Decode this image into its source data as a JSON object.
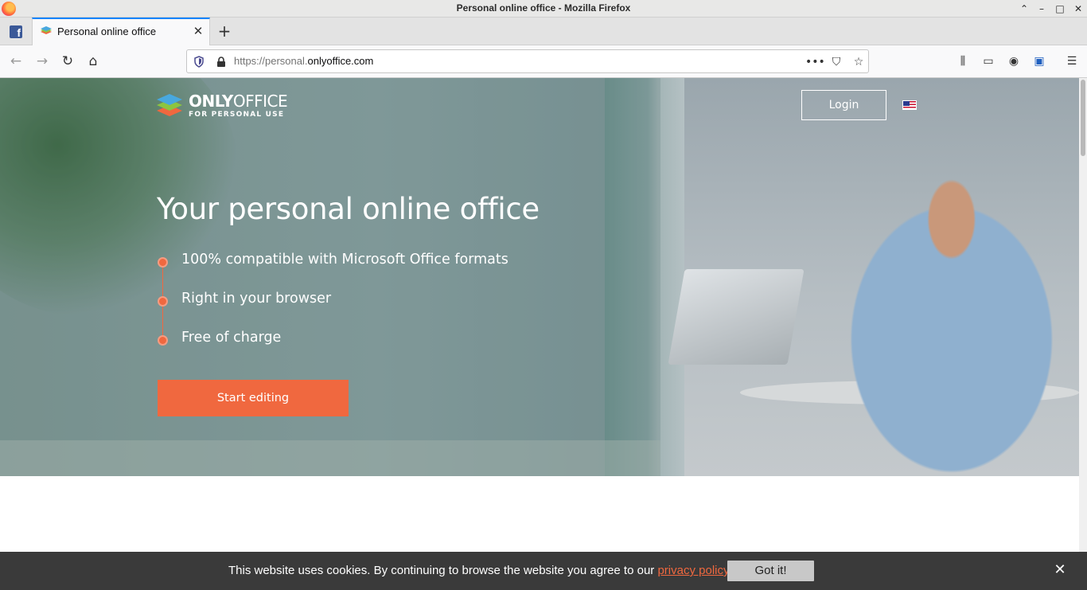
{
  "window": {
    "title": "Personal online office - Mozilla Firefox",
    "controls": {
      "restore": "⌃",
      "minimize": "–",
      "maximize": "□",
      "close": "✕"
    }
  },
  "tabs": [
    {
      "label": "Facebook",
      "icon": "facebook-icon",
      "active": false
    },
    {
      "label": "Personal online office",
      "icon": "onlyoffice-favicon",
      "active": true
    }
  ],
  "toolbar": {
    "back": "←",
    "forward": "→",
    "reload": "↻",
    "home": "⌂",
    "new_tab": "+",
    "tab_close": "✕"
  },
  "urlbar": {
    "url_prefix": "https://personal.",
    "url_domain": "onlyoffice.com",
    "actions": {
      "more": "•••",
      "pocket": "⛉",
      "bookmark": "☆"
    }
  },
  "tools": {
    "library": "⫼",
    "sidebar": "▭",
    "account": "◉",
    "extension": "▣",
    "menu": "☰"
  },
  "site": {
    "logo_name_a": "ONLY",
    "logo_name_b": "OFFICE",
    "logo_sub": "FOR PERSONAL USE",
    "login_label": "Login",
    "language": "English (US)",
    "headline": "Your personal online office",
    "features": [
      "100% compatible with Microsoft Office formats",
      "Right in your browser",
      "Free of charge"
    ],
    "cta_label": "Start editing",
    "accent": "#f0683f"
  },
  "cookie": {
    "text": "This website uses cookies. By continuing to browse the website you agree to our ",
    "link_label": "privacy policy",
    "button_label": "Got it!",
    "close": "✕"
  }
}
